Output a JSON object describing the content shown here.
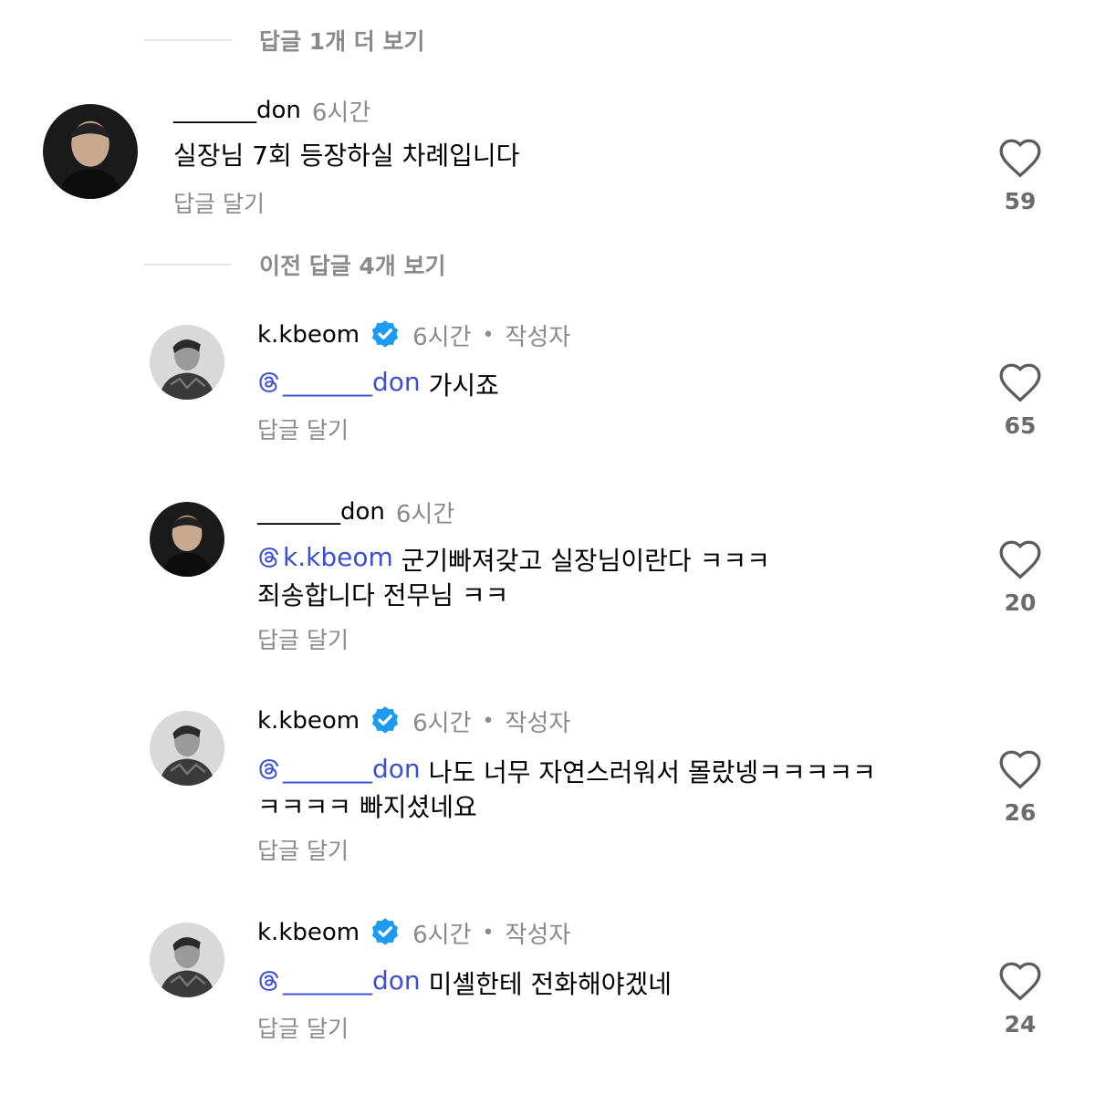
{
  "view_more_top": {
    "label": "답글 1개 더 보기"
  },
  "view_prev": {
    "label": "이전 답글 4개 보기"
  },
  "comments": [
    {
      "username": "_______don",
      "time": "6시간",
      "text": "실장님 7회 등장하실 차례입니다",
      "reply_label": "답글 달기",
      "likes": "59"
    },
    {
      "username": "k.kbeom",
      "time": "6시간",
      "author_label": "작성자",
      "mention": "_______don",
      "text": "가시죠",
      "reply_label": "답글 달기",
      "likes": "65"
    },
    {
      "username": "_______don",
      "time": "6시간",
      "mention": "k.kbeom",
      "text": "군기빠져갖고 실장님이란다 ㅋㅋㅋ",
      "text2": "죄송합니다 전무님 ㅋㅋ",
      "reply_label": "답글 달기",
      "likes": "20"
    },
    {
      "username": "k.kbeom",
      "time": "6시간",
      "author_label": "작성자",
      "mention": "_______don",
      "text": "나도 너무 자연스러워서 몰랐넹ㅋㅋㅋㅋㅋ",
      "text2": "ㅋㅋㅋㅋ 빠지셨네요",
      "reply_label": "답글 달기",
      "likes": "26"
    },
    {
      "username": "k.kbeom",
      "time": "6시간",
      "author_label": "작성자",
      "mention": "_______don",
      "text": "미셸한테 전화해야겠네",
      "reply_label": "답글 달기",
      "likes": "24"
    }
  ],
  "colors": {
    "mention": "#3b4fd1",
    "verified": "#1d9bf0",
    "muted": "#8a8a8a"
  },
  "icons": {
    "like": "heart-outline-icon",
    "verified": "verified-badge-icon",
    "mention": "threads-mention-icon"
  }
}
